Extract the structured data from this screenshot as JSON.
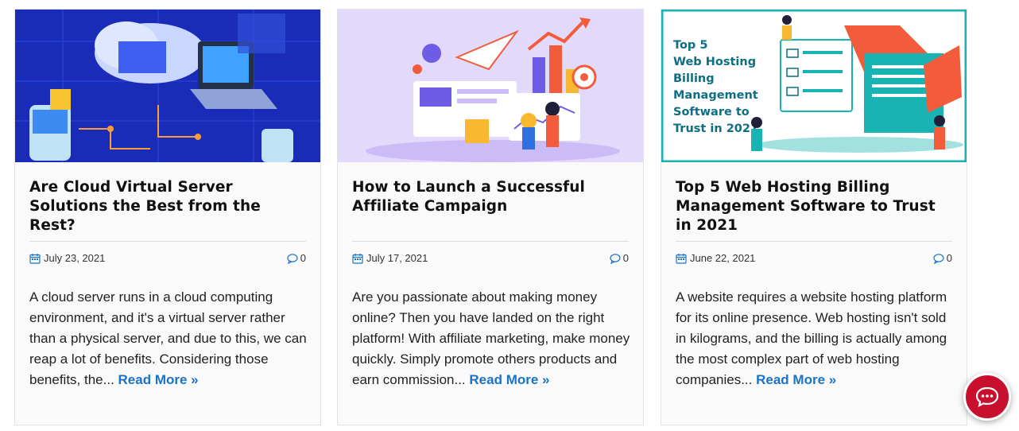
{
  "posts": [
    {
      "title": "Are Cloud Virtual Server Solutions the Best from the Rest?",
      "date": "July 23, 2021",
      "comments": "0",
      "excerpt": "A cloud server runs in a cloud computing environment, and it's a virtual server rather than a physical server, and due to this, we can reap a lot of benefits. Considering those benefits, the...",
      "read_more": "Read More »",
      "image_theme": "cloud-servers-isometric",
      "image_bg": "#1a2bb8"
    },
    {
      "title": "How to Launch a Successful Affiliate Campaign",
      "date": "July 17, 2021",
      "comments": "0",
      "excerpt": "Are you passionate about making money online? Then you have landed on the right platform! With affiliate marketing, make money quickly. Simply promote others products and earn commission...",
      "read_more": "Read More »",
      "image_theme": "affiliate-marketing-illustration",
      "image_bg": "#e3d9fb"
    },
    {
      "title": "Top 5 Web Hosting Billing Management Software to Trust in 2021",
      "date": "June 22, 2021",
      "comments": "0",
      "excerpt": "A website requires a website hosting platform for its online presence. Web hosting isn't sold in kilograms, and the billing is actually among the most complex part of web hosting companies...",
      "read_more": "Read More »",
      "image_theme": "billing-software-illustration",
      "image_bg": "#ffffff",
      "image_text": "Top 5\nWeb Hosting\nBilling\nManagement\nSoftware to\nTrust in 2021"
    }
  ],
  "colors": {
    "link": "#1a73c8",
    "chat_button": "#c8102e",
    "icon": "#1a73c8"
  },
  "icons": {
    "date": "calendar-icon",
    "comments": "comment-bubble-icon",
    "chat": "chat-icon"
  }
}
